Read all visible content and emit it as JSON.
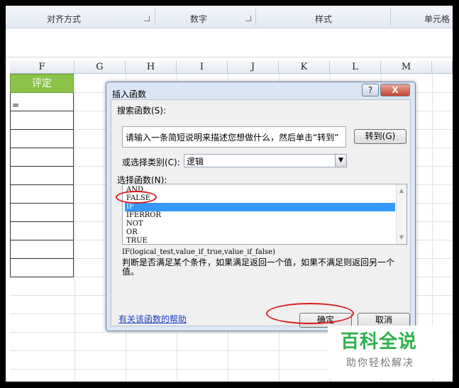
{
  "ribbon": {
    "groups": [
      "对齐方式",
      "数字",
      "样式",
      "单元格"
    ]
  },
  "sheet": {
    "columns": [
      "F",
      "G",
      "H",
      "I",
      "J",
      "K",
      "L",
      "M"
    ],
    "header_cell": "评定",
    "cell_f3": "="
  },
  "dialog": {
    "title": "插入函数",
    "help_button": "?",
    "close_button": "X",
    "search_label": "搜索函数(S):",
    "search_value": "请输入一条简短说明来描述您想做什么，然后单击“转到”",
    "goto_button": "转到(G)",
    "category_label": "或选择类别(C):",
    "category_value": "逻辑",
    "function_label": "选择函数(N):",
    "functions": [
      "AND",
      "FALSE",
      "IF",
      "IFERROR",
      "NOT",
      "OR",
      "TRUE"
    ],
    "selected_function": "IF",
    "syntax": "IF(logical_test,value_if_true,value_if_false)",
    "description": "判断是否满足某个条件，如果满足返回一个值，如果不满足则返回另一个值。",
    "help_link": "有关该函数的帮助",
    "ok_button": "确定",
    "cancel_button": "取消"
  },
  "watermark": {
    "main": "百科全说",
    "sub": "助你轻松解决"
  },
  "colors": {
    "highlight": "#3399ff",
    "annotation": "#d91e1e",
    "header_green": "#8bc34a",
    "watermark_green": "#2fb14a"
  }
}
